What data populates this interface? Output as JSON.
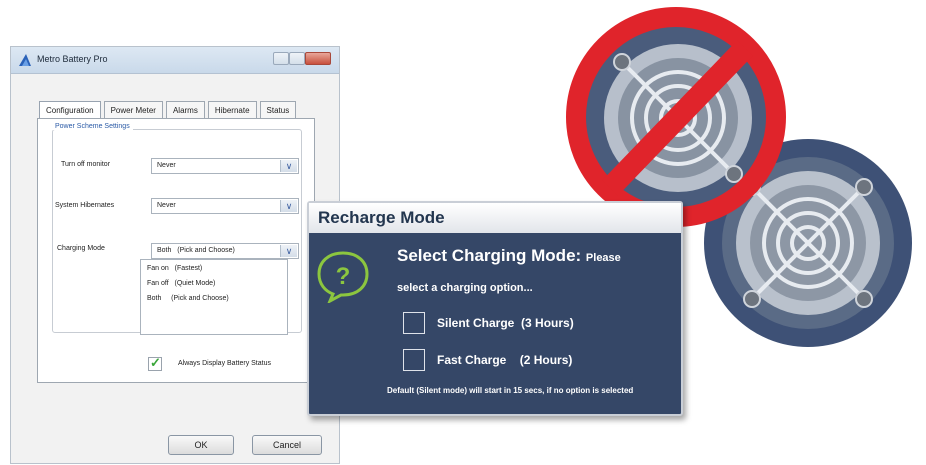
{
  "window": {
    "title": "Metro Battery Pro",
    "tabs": [
      "Configuration",
      "Power Meter",
      "Alarms",
      "Hibernate",
      "Status"
    ],
    "group_title": "Power Scheme Settings",
    "fields": {
      "turn_off_monitor": {
        "label": "Turn off monitor",
        "value": "Never"
      },
      "system_hibernates": {
        "label": "System Hibernates",
        "value": "Never"
      },
      "charging_mode": {
        "label": "Charging Mode",
        "value_mode": "Both",
        "value_desc": "(Pick and Choose)"
      }
    },
    "dropdown_options": [
      {
        "mode": "Fan on",
        "desc": "(Fastest)"
      },
      {
        "mode": "Fan off",
        "desc": "(Quiet Mode)"
      },
      {
        "mode": "Both",
        "desc": "(Pick and Choose)"
      }
    ],
    "always_display_label": "Always Display Battery Status",
    "always_display_checked": true,
    "ok_label": "OK",
    "cancel_label": "Cancel"
  },
  "popup": {
    "title": "Recharge Mode",
    "heading_big": "Select Charging Mode:",
    "heading_small": "Please",
    "subheading": "select a charging option...",
    "options": [
      {
        "label": "Silent Charge",
        "duration": "(3 Hours)"
      },
      {
        "label": "Fast Charge",
        "duration": "(2 Hours)"
      }
    ],
    "note": "Default (Silent mode) will start in 15 secs, if no option is selected"
  },
  "colors": {
    "popup_bg": "#354767",
    "accent_green": "#8cc63f",
    "prohibit_red": "#e0242b"
  },
  "icons": [
    "help-bubble-icon",
    "checkmark-icon",
    "chevron-down-icon",
    "prohibited-icon",
    "fan-icon"
  ]
}
